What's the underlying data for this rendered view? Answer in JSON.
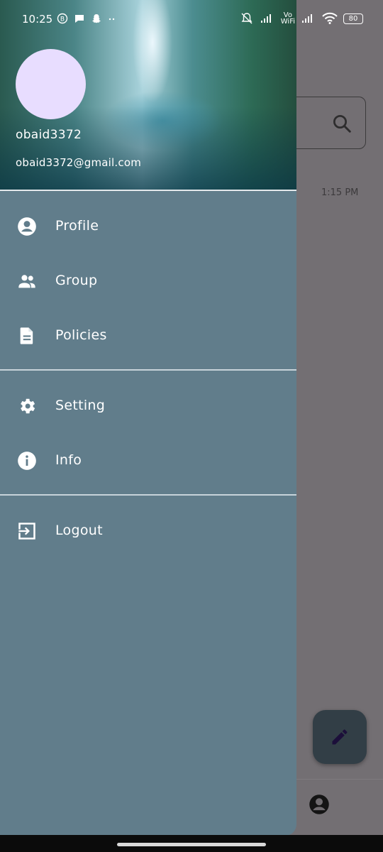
{
  "status_bar": {
    "time": "10:25",
    "vo_label": "Vo",
    "wifi_label": "WiFi",
    "battery": "80"
  },
  "drawer": {
    "user": {
      "name": "obaid3372",
      "email": "obaid3372@gmail.com"
    },
    "items": [
      {
        "label": "Profile",
        "icon": "account-circle-icon"
      },
      {
        "label": "Group",
        "icon": "group-icon"
      },
      {
        "label": "Policies",
        "icon": "document-icon"
      },
      {
        "label": "Setting",
        "icon": "gear-icon"
      },
      {
        "label": "Info",
        "icon": "info-icon"
      },
      {
        "label": "Logout",
        "icon": "logout-icon"
      }
    ]
  },
  "background": {
    "message_time": "1:15 PM"
  },
  "colors": {
    "drawer_bg": "#617d8b",
    "avatar_bg": "#e8ddff",
    "fab_bg": "#323e46"
  }
}
